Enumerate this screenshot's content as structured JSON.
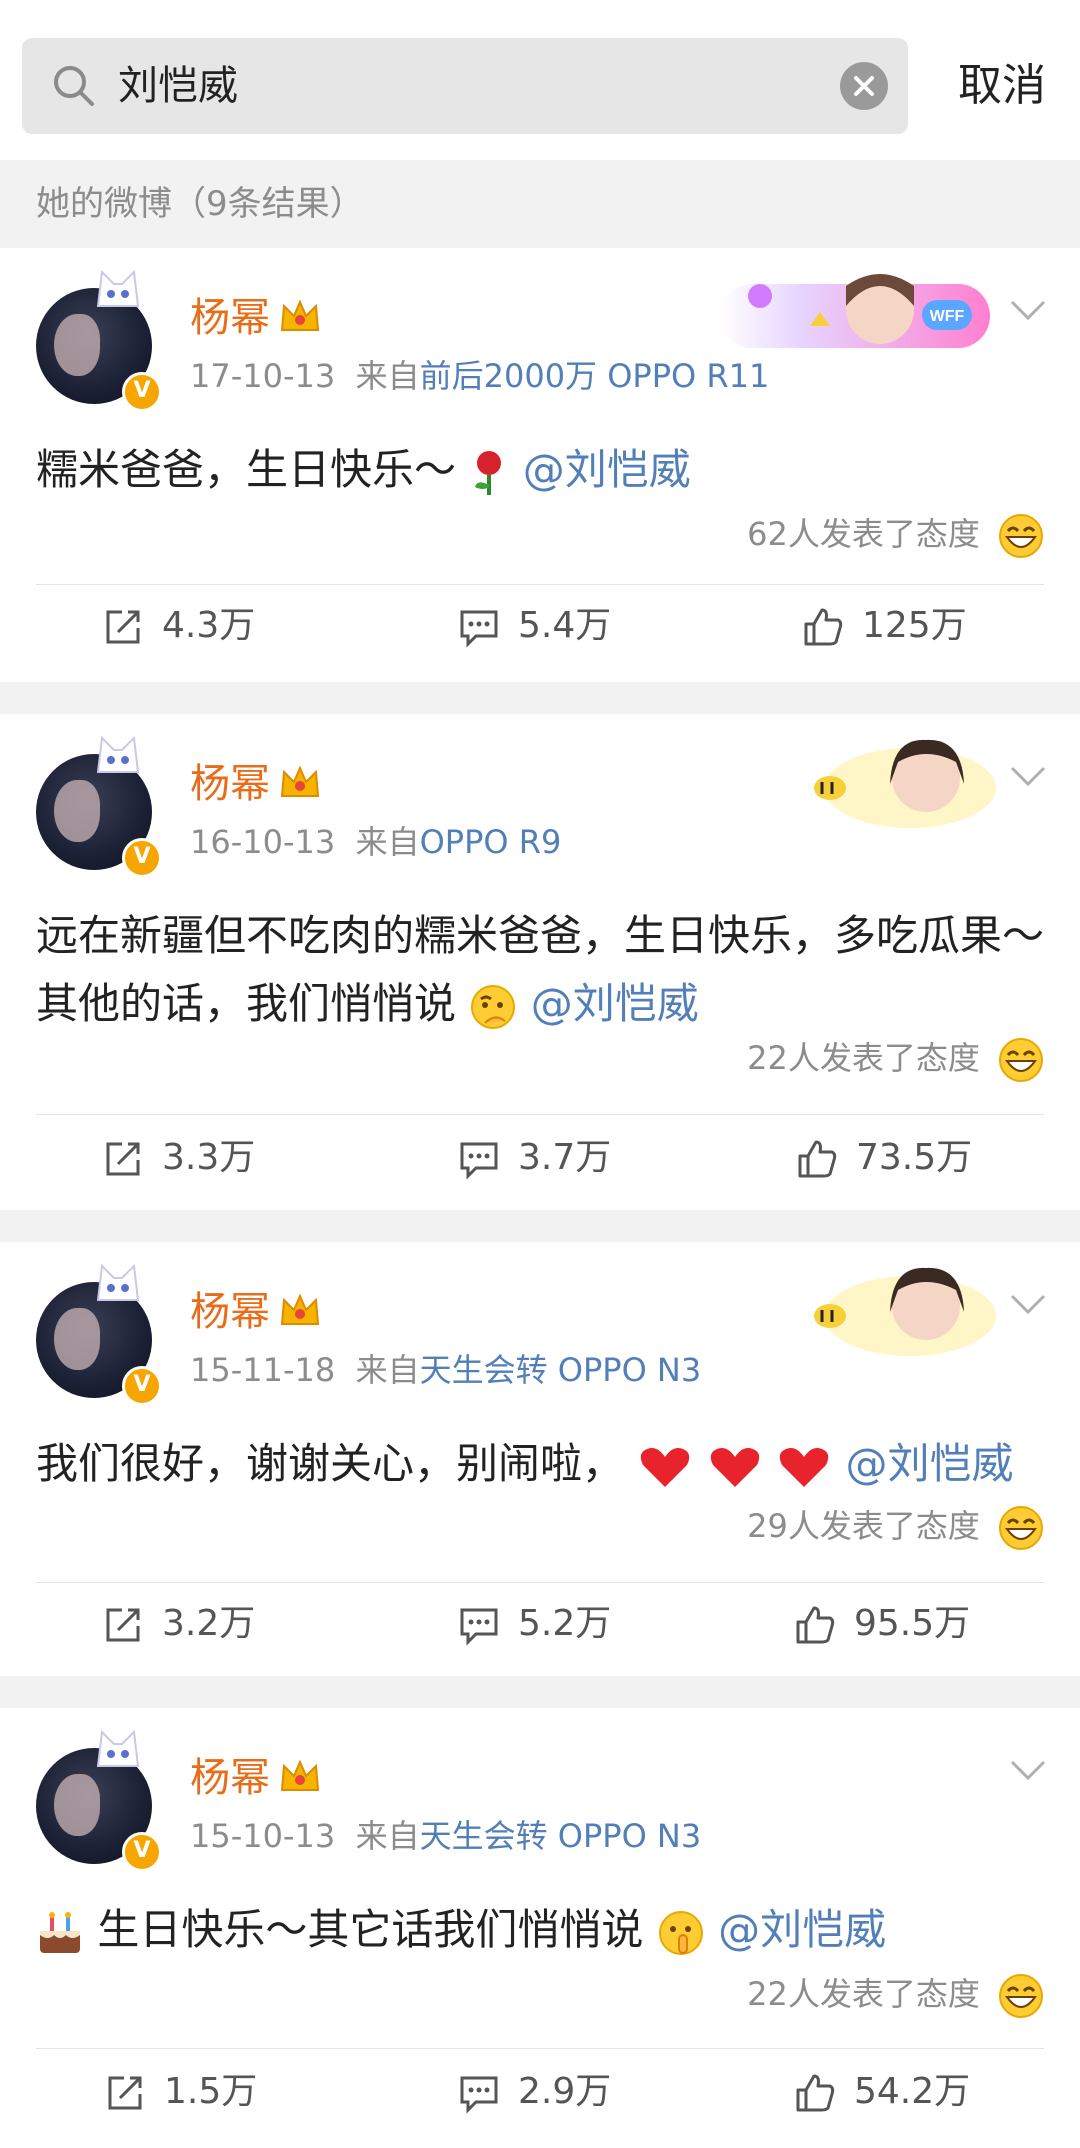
{
  "search": {
    "query": "刘恺威",
    "cancel_label": "取消"
  },
  "results": {
    "header": "她的微博（9条结果）"
  },
  "posts": [
    {
      "author": "杨幂",
      "date": "17-10-13",
      "from_label": "来自",
      "source": "前后2000万 OPPO R11",
      "text": "糯米爸爸，生日快乐～",
      "mention": "@刘恺威",
      "reactions": "62人发表了态度",
      "reposts": "4.3万",
      "comments": "5.4万",
      "likes": "125万",
      "banner_text": "WFF"
    },
    {
      "author": "杨幂",
      "date": "16-10-13",
      "from_label": "来自",
      "source": "OPPO R9",
      "text": "远在新疆但不吃肉的糯米爸爸，生日快乐，多吃瓜果～其他的话，我们悄悄说",
      "mention": "@刘恺威",
      "reactions": "22人发表了态度",
      "reposts": "3.3万",
      "comments": "3.7万",
      "likes": "73.5万"
    },
    {
      "author": "杨幂",
      "date": "15-11-18",
      "from_label": "来自",
      "source": "天生会转 OPPO N3",
      "text": "我们很好，谢谢关心，别闹啦，",
      "mention": "@刘恺威",
      "reactions": "29人发表了态度",
      "reposts": "3.2万",
      "comments": "5.2万",
      "likes": "95.5万"
    },
    {
      "author": "杨幂",
      "date": "15-10-13",
      "from_label": "来自",
      "source": "天生会转 OPPO N3",
      "text": "生日快乐～其它话我们悄悄说",
      "mention": "@刘恺威",
      "reactions": "22人发表了态度",
      "reposts": "1.5万",
      "comments": "2.9万",
      "likes": "54.2万"
    }
  ],
  "icons": {
    "search": "search-icon",
    "clear": "clear-icon",
    "crown": "crown-icon",
    "verified": "verified-badge-icon",
    "dropdown": "chevron-down-icon",
    "repost": "repost-icon",
    "comment": "comment-icon",
    "like": "thumbs-up-icon",
    "reaction": "smile-emoji-icon"
  },
  "colors": {
    "username": "#e86d1a",
    "link": "#527fb8",
    "meta": "#8c8c8c",
    "verified": "#f7a600"
  }
}
